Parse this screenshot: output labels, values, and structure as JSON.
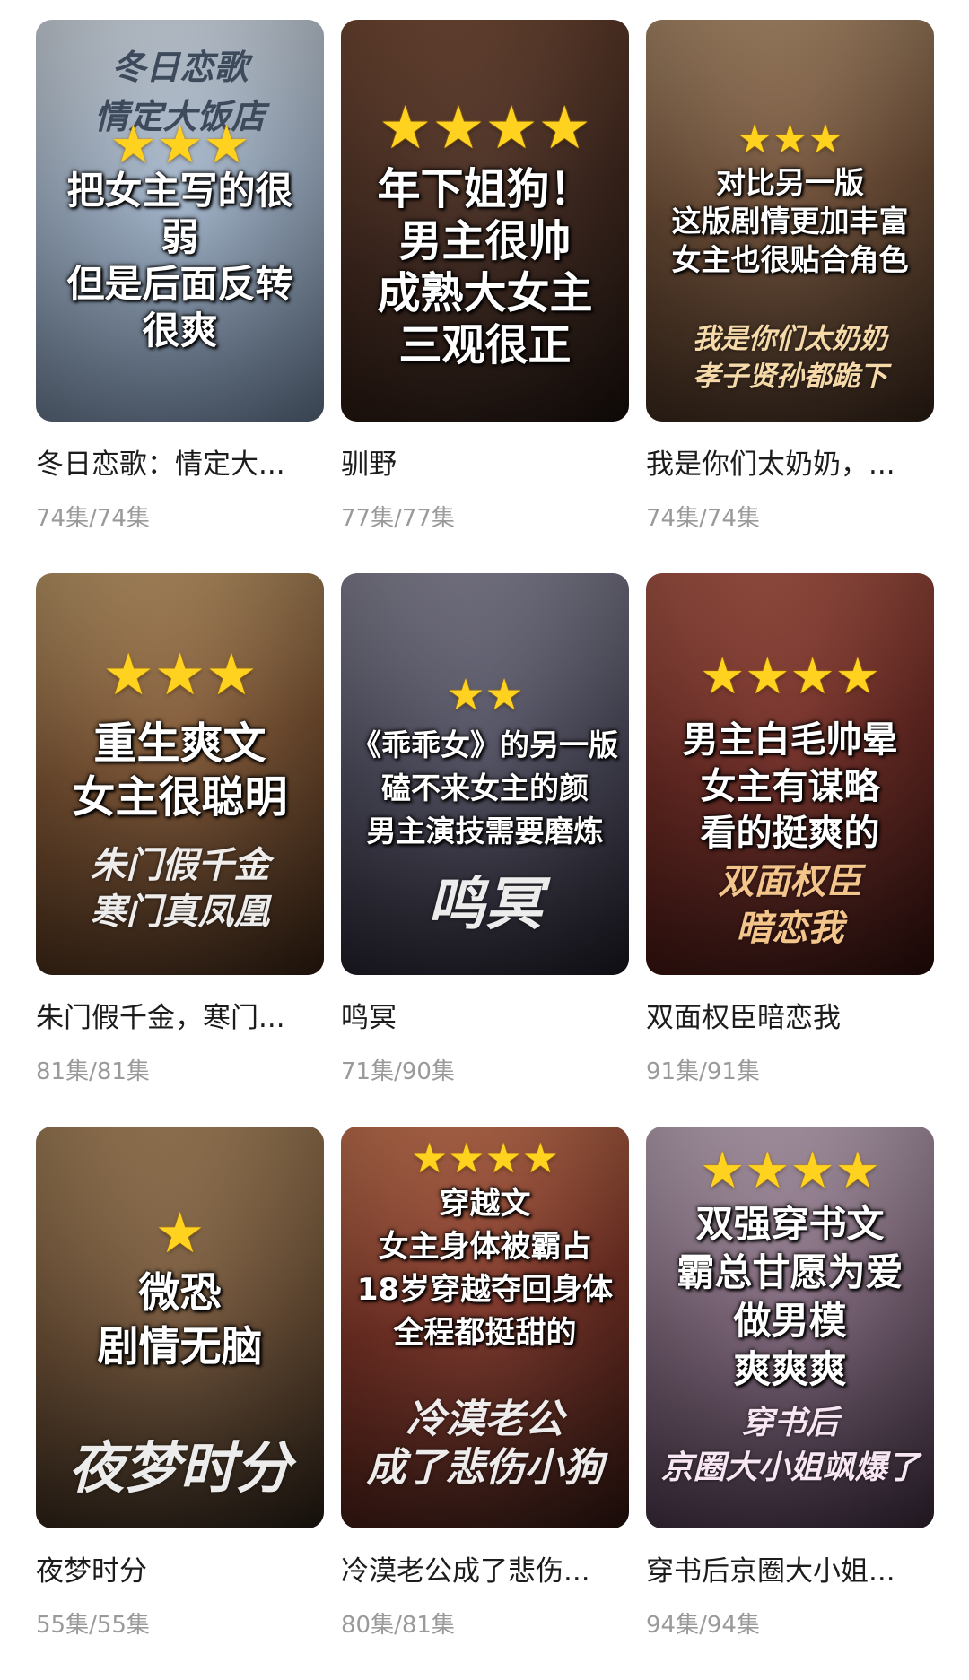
{
  "items": [
    {
      "title": "冬日恋歌：情定大...",
      "episodes": "74集/74集",
      "stars": "★★★",
      "overlay": "把女主写的很\n弱\n但是后面反转\n很爽",
      "poster_title": "冬日恋歌\n情定大饭店",
      "bg": [
        "#c9d6e6",
        "#6e7f94"
      ]
    },
    {
      "title": "驯野",
      "episodes": "77集/77集",
      "stars": "★★★★",
      "overlay": "年下姐狗！\n男主很帅\n成熟大女主\n三观很正",
      "poster_title": "",
      "bg": [
        "#5b3a2c",
        "#1f1512"
      ]
    },
    {
      "title": "我是你们太奶奶，...",
      "episodes": "74集/74集",
      "stars": "★★★",
      "overlay": "对比另一版\n这版剧情更加丰富\n女主也很贴合角色",
      "poster_title": "我是你们太奶奶\n孝子贤孙都跪下",
      "bg": [
        "#8a6848",
        "#3b2a1f"
      ]
    },
    {
      "title": "朱门假千金，寒门...",
      "episodes": "81集/81集",
      "stars": "★★★",
      "overlay": "重生爽文\n女主很聪明",
      "poster_title": "朱门假千金\n寒门真凤凰",
      "bg": [
        "#a7794a",
        "#3e2616"
      ]
    },
    {
      "title": "鸣冥",
      "episodes": "71集/90集",
      "stars": "★★",
      "overlay": "《乖乖女》的另一版\n磕不来女主的颜\n男主演技需要磨炼",
      "poster_title": "鸣冥",
      "bg": [
        "#6c6a7c",
        "#1d1c28"
      ]
    },
    {
      "title": "双面权臣暗恋我",
      "episodes": "91集/91集",
      "stars": "★★★★",
      "overlay": "男主白毛帅晕\n女主有谋略\n看的挺爽的",
      "poster_title": "双面权臣\n暗恋我",
      "bg": [
        "#8a3a33",
        "#2b0f0c"
      ]
    },
    {
      "title": "夜梦时分",
      "episodes": "55集/55集",
      "stars": "★",
      "overlay": "微恐\n剧情无脑",
      "poster_title": "夜梦时分",
      "bg": [
        "#8f6a45",
        "#2e2218"
      ]
    },
    {
      "title": "冷漠老公成了悲伤...",
      "episodes": "80集/81集",
      "stars": "★★★★",
      "overlay": "穿越文\n女主身体被霸占\n18岁穿越夺回身体\n全程都挺甜的",
      "poster_title": "冷漠老公\n成了悲伤小狗",
      "bg": [
        "#b5553d",
        "#3a1712"
      ]
    },
    {
      "title": "穿书后京圈大小姐...",
      "episodes": "94集/94集",
      "stars": "★★★★",
      "overlay": "双强穿书文\n霸总甘愿为爱\n做男模\n爽爽爽",
      "poster_title": "穿书后\n京圈大小姐飒爆了",
      "bg": [
        "#a58aa0",
        "#3b2c3c"
      ]
    }
  ]
}
